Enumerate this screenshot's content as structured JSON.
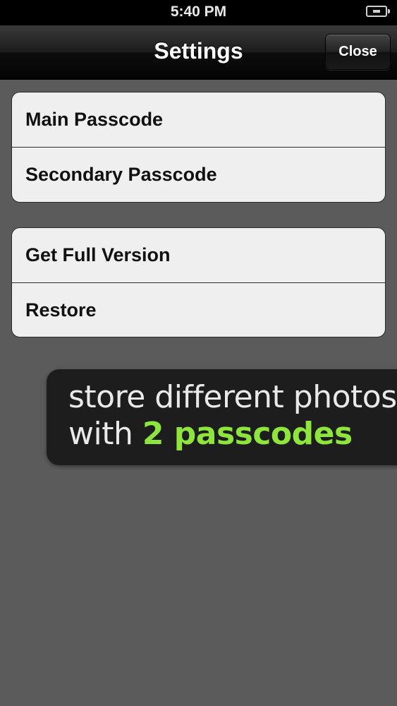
{
  "status_bar": {
    "time": "5:40 PM",
    "battery_icon": "battery-charging-icon"
  },
  "nav": {
    "title": "Settings",
    "close_label": "Close"
  },
  "groups": [
    {
      "items": [
        {
          "label": "Main Passcode"
        },
        {
          "label": "Secondary Passcode"
        }
      ]
    },
    {
      "items": [
        {
          "label": "Get Full Version"
        },
        {
          "label": "Restore"
        }
      ]
    }
  ],
  "promo": {
    "line1": "store different photos",
    "line2_prefix": "with ",
    "line2_highlight": "2 passcodes",
    "highlight_color": "#8fe63a"
  },
  "colors": {
    "background": "#5b5b5b",
    "cell_background": "#efefef",
    "navbar": "#1c1c1c"
  }
}
